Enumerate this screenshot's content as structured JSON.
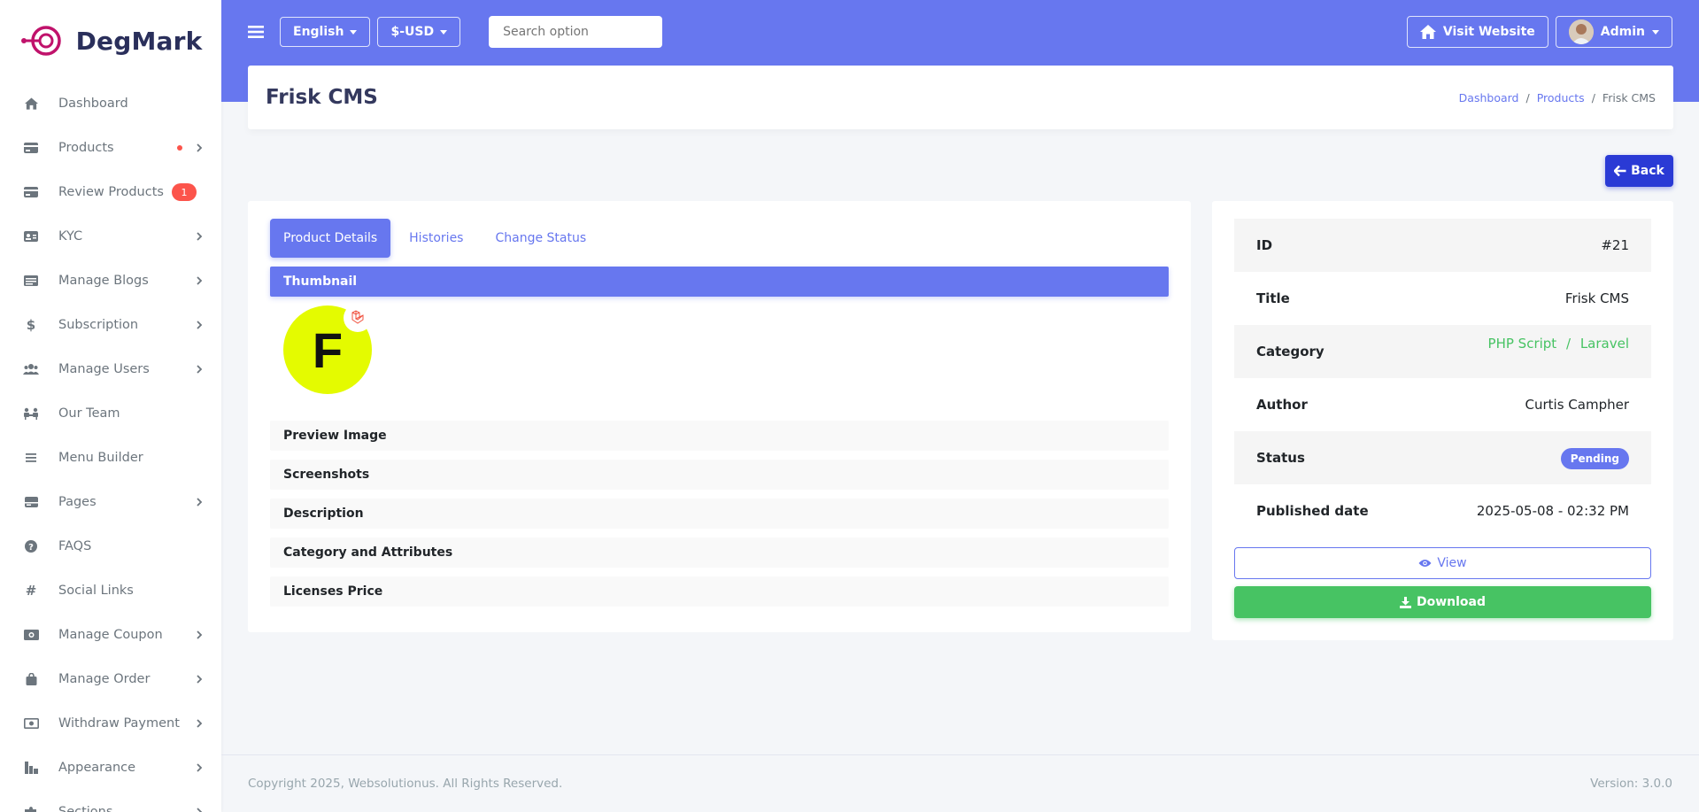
{
  "brand": {
    "name": "DegMark"
  },
  "sidebar": {
    "items": [
      {
        "label": "Dashboard",
        "icon": "home-icon",
        "chevron": false
      },
      {
        "label": "Products",
        "icon": "card-icon",
        "chevron": true,
        "dot": true
      },
      {
        "label": "Review Products",
        "icon": "card-icon",
        "chevron": false,
        "badge": "1"
      },
      {
        "label": "KYC",
        "icon": "id-card-icon",
        "chevron": true
      },
      {
        "label": "Manage Blogs",
        "icon": "blog-icon",
        "chevron": true
      },
      {
        "label": "Subscription",
        "icon": "dollar-icon",
        "chevron": true
      },
      {
        "label": "Manage Users",
        "icon": "users-icon",
        "chevron": true
      },
      {
        "label": "Our Team",
        "icon": "team-icon",
        "chevron": false
      },
      {
        "label": "Menu Builder",
        "icon": "bars-icon",
        "chevron": false
      },
      {
        "label": "Pages",
        "icon": "page-icon",
        "chevron": true
      },
      {
        "label": "FAQS",
        "icon": "question-icon",
        "chevron": false
      },
      {
        "label": "Social Links",
        "icon": "hash-icon",
        "chevron": false
      },
      {
        "label": "Manage Coupon",
        "icon": "coupon-icon",
        "chevron": true
      },
      {
        "label": "Manage Order",
        "icon": "bag-icon",
        "chevron": true
      },
      {
        "label": "Withdraw Payment",
        "icon": "money-icon",
        "chevron": true
      },
      {
        "label": "Appearance",
        "icon": "palette-icon",
        "chevron": true
      },
      {
        "label": "Sections",
        "icon": "puzzle-icon",
        "chevron": true
      }
    ]
  },
  "navbar": {
    "language": "English",
    "currency": "$-USD",
    "search_placeholder": "Search option",
    "visit_website": "Visit Website",
    "admin": "Admin"
  },
  "page": {
    "title": "Frisk CMS",
    "breadcrumb": [
      "Dashboard",
      "Products",
      "Frisk CMS"
    ],
    "back": "Back"
  },
  "tabs": [
    "Product Details",
    "Histories",
    "Change Status"
  ],
  "details": {
    "thumbnail_header": "Thumbnail",
    "thumb_letter": "F",
    "sections": [
      "Preview Image",
      "Screenshots",
      "Description",
      "Category and Attributes",
      "Licenses Price"
    ]
  },
  "info": {
    "id_label": "ID",
    "id_value": "#21",
    "title_label": "Title",
    "title_value": "Frisk CMS",
    "category_label": "Category",
    "category_main": "PHP Script",
    "category_sep": "/",
    "category_sub": "Laravel",
    "author_label": "Author",
    "author_value": "Curtis Campher",
    "status_label": "Status",
    "status_value": "Pending",
    "published_label": "Published date",
    "published_value": "2025-05-08 - 02:32 PM",
    "view": "View",
    "download": "Download"
  },
  "footer": {
    "copyright": "Copyright 2025, Websolutionus. All Rights Reserved.",
    "version": "Version: 3.0.0"
  },
  "colors": {
    "primary": "#6777ef",
    "success": "#47c363",
    "danger": "#fc544b",
    "back_btn": "#2a3ad5"
  }
}
